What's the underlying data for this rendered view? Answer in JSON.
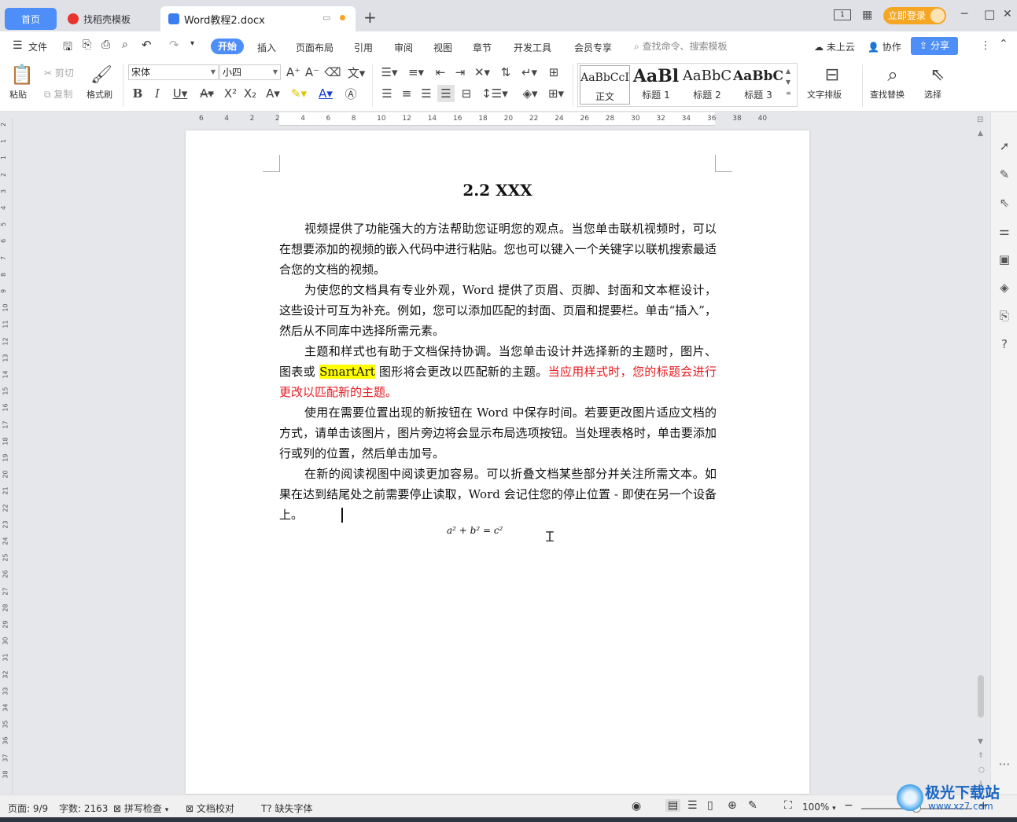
{
  "tabs": {
    "home": "首页",
    "template": "找稻壳模板",
    "doc": "Word教程2.docx",
    "add": "+"
  },
  "titlebar": {
    "login": "立即登录",
    "minimize": "─",
    "maximize": "□",
    "close": "✕"
  },
  "menu": {
    "file": "文件",
    "items": [
      "开始",
      "插入",
      "页面布局",
      "引用",
      "审阅",
      "视图",
      "章节",
      "开发工具",
      "会员专享"
    ],
    "search_placeholder": "查找命令、搜索模板",
    "cloud": "未上云",
    "collab": "协作",
    "share": "分享"
  },
  "ribbon": {
    "paste": "粘贴",
    "cut": "剪切",
    "copy": "复制",
    "format_painter": "格式刷",
    "font_name": "宋体",
    "font_size": "小四",
    "styles": [
      {
        "preview": "AaBbCcI",
        "name": "正文"
      },
      {
        "preview": "AaBl",
        "name": "标题 1"
      },
      {
        "preview": "AaBbC",
        "name": "标题 2"
      },
      {
        "preview": "AaBbC",
        "name": "标题 3"
      }
    ],
    "text_layout": "文字排版",
    "find_replace": "查找替换",
    "select": "选择"
  },
  "ruler": {
    "ticks": [
      "6",
      "4",
      "2",
      "2",
      "4",
      "6",
      "8",
      "10",
      "12",
      "14",
      "16",
      "18",
      "20",
      "22",
      "24",
      "26",
      "28",
      "30",
      "32",
      "34",
      "36",
      "38",
      "40"
    ],
    "vticks": [
      "2",
      "1",
      "1",
      "2",
      "3",
      "4",
      "5",
      "6",
      "7",
      "8",
      "9",
      "10",
      "11",
      "12",
      "13",
      "14",
      "15",
      "16",
      "17",
      "18",
      "19",
      "20",
      "21",
      "22",
      "23",
      "24",
      "25",
      "26",
      "27",
      "28",
      "29",
      "30",
      "31",
      "32",
      "33",
      "34",
      "35",
      "36",
      "37",
      "38"
    ]
  },
  "document": {
    "heading": "2.2 XXX",
    "p1": "视频提供了功能强大的方法帮助您证明您的观点。当您单击联机视频时，可以在想要添加的视频的嵌入代码中进行粘贴。您也可以键入一个关键字以联机搜索最适合您的文档的视频。",
    "p2": "为使您的文档具有专业外观，Word 提供了页眉、页脚、封面和文本框设计，这些设计可互为补充。例如，您可以添加匹配的封面、页眉和提要栏。单击“插入”，然后从不同库中选择所需元素。",
    "p3a": "主题和样式也有助于文档保持协调。当您单击设计并选择新的主题时，图片、图表或 ",
    "p3hl": "SmartArt",
    "p3b": " 图形将会更改以匹配新的主题。",
    "p3red": "当应用样式时，您的标题会进行更改以匹配新的主题。",
    "p4": "使用在需要位置出现的新按钮在 Word 中保存时间。若要更改图片适应文档的方式，请单击该图片，图片旁边将会显示布局选项按钮。当处理表格时，单击要添加行或列的位置，然后单击加号。",
    "p5": "在新的阅读视图中阅读更加容易。可以折叠文档某些部分并关注所需文本。如果在达到结尾处之前需要停止读取，Word 会记住您的停止位置 - 即使在另一个设备上。",
    "formula": "a² + b² = c²"
  },
  "status": {
    "page": "页面: 9/9",
    "words": "字数: 2163",
    "spell": "拼写检查",
    "proof": "文档校对",
    "missing_font": "缺失字体",
    "zoom": "100%"
  },
  "watermark": {
    "name": "极光下载站",
    "url": "www.xz7.com"
  },
  "colors": {
    "accent": "#4d8ef8",
    "login": "#f5a623",
    "highlight": "#ffff00",
    "red_text": "#e8191e"
  }
}
